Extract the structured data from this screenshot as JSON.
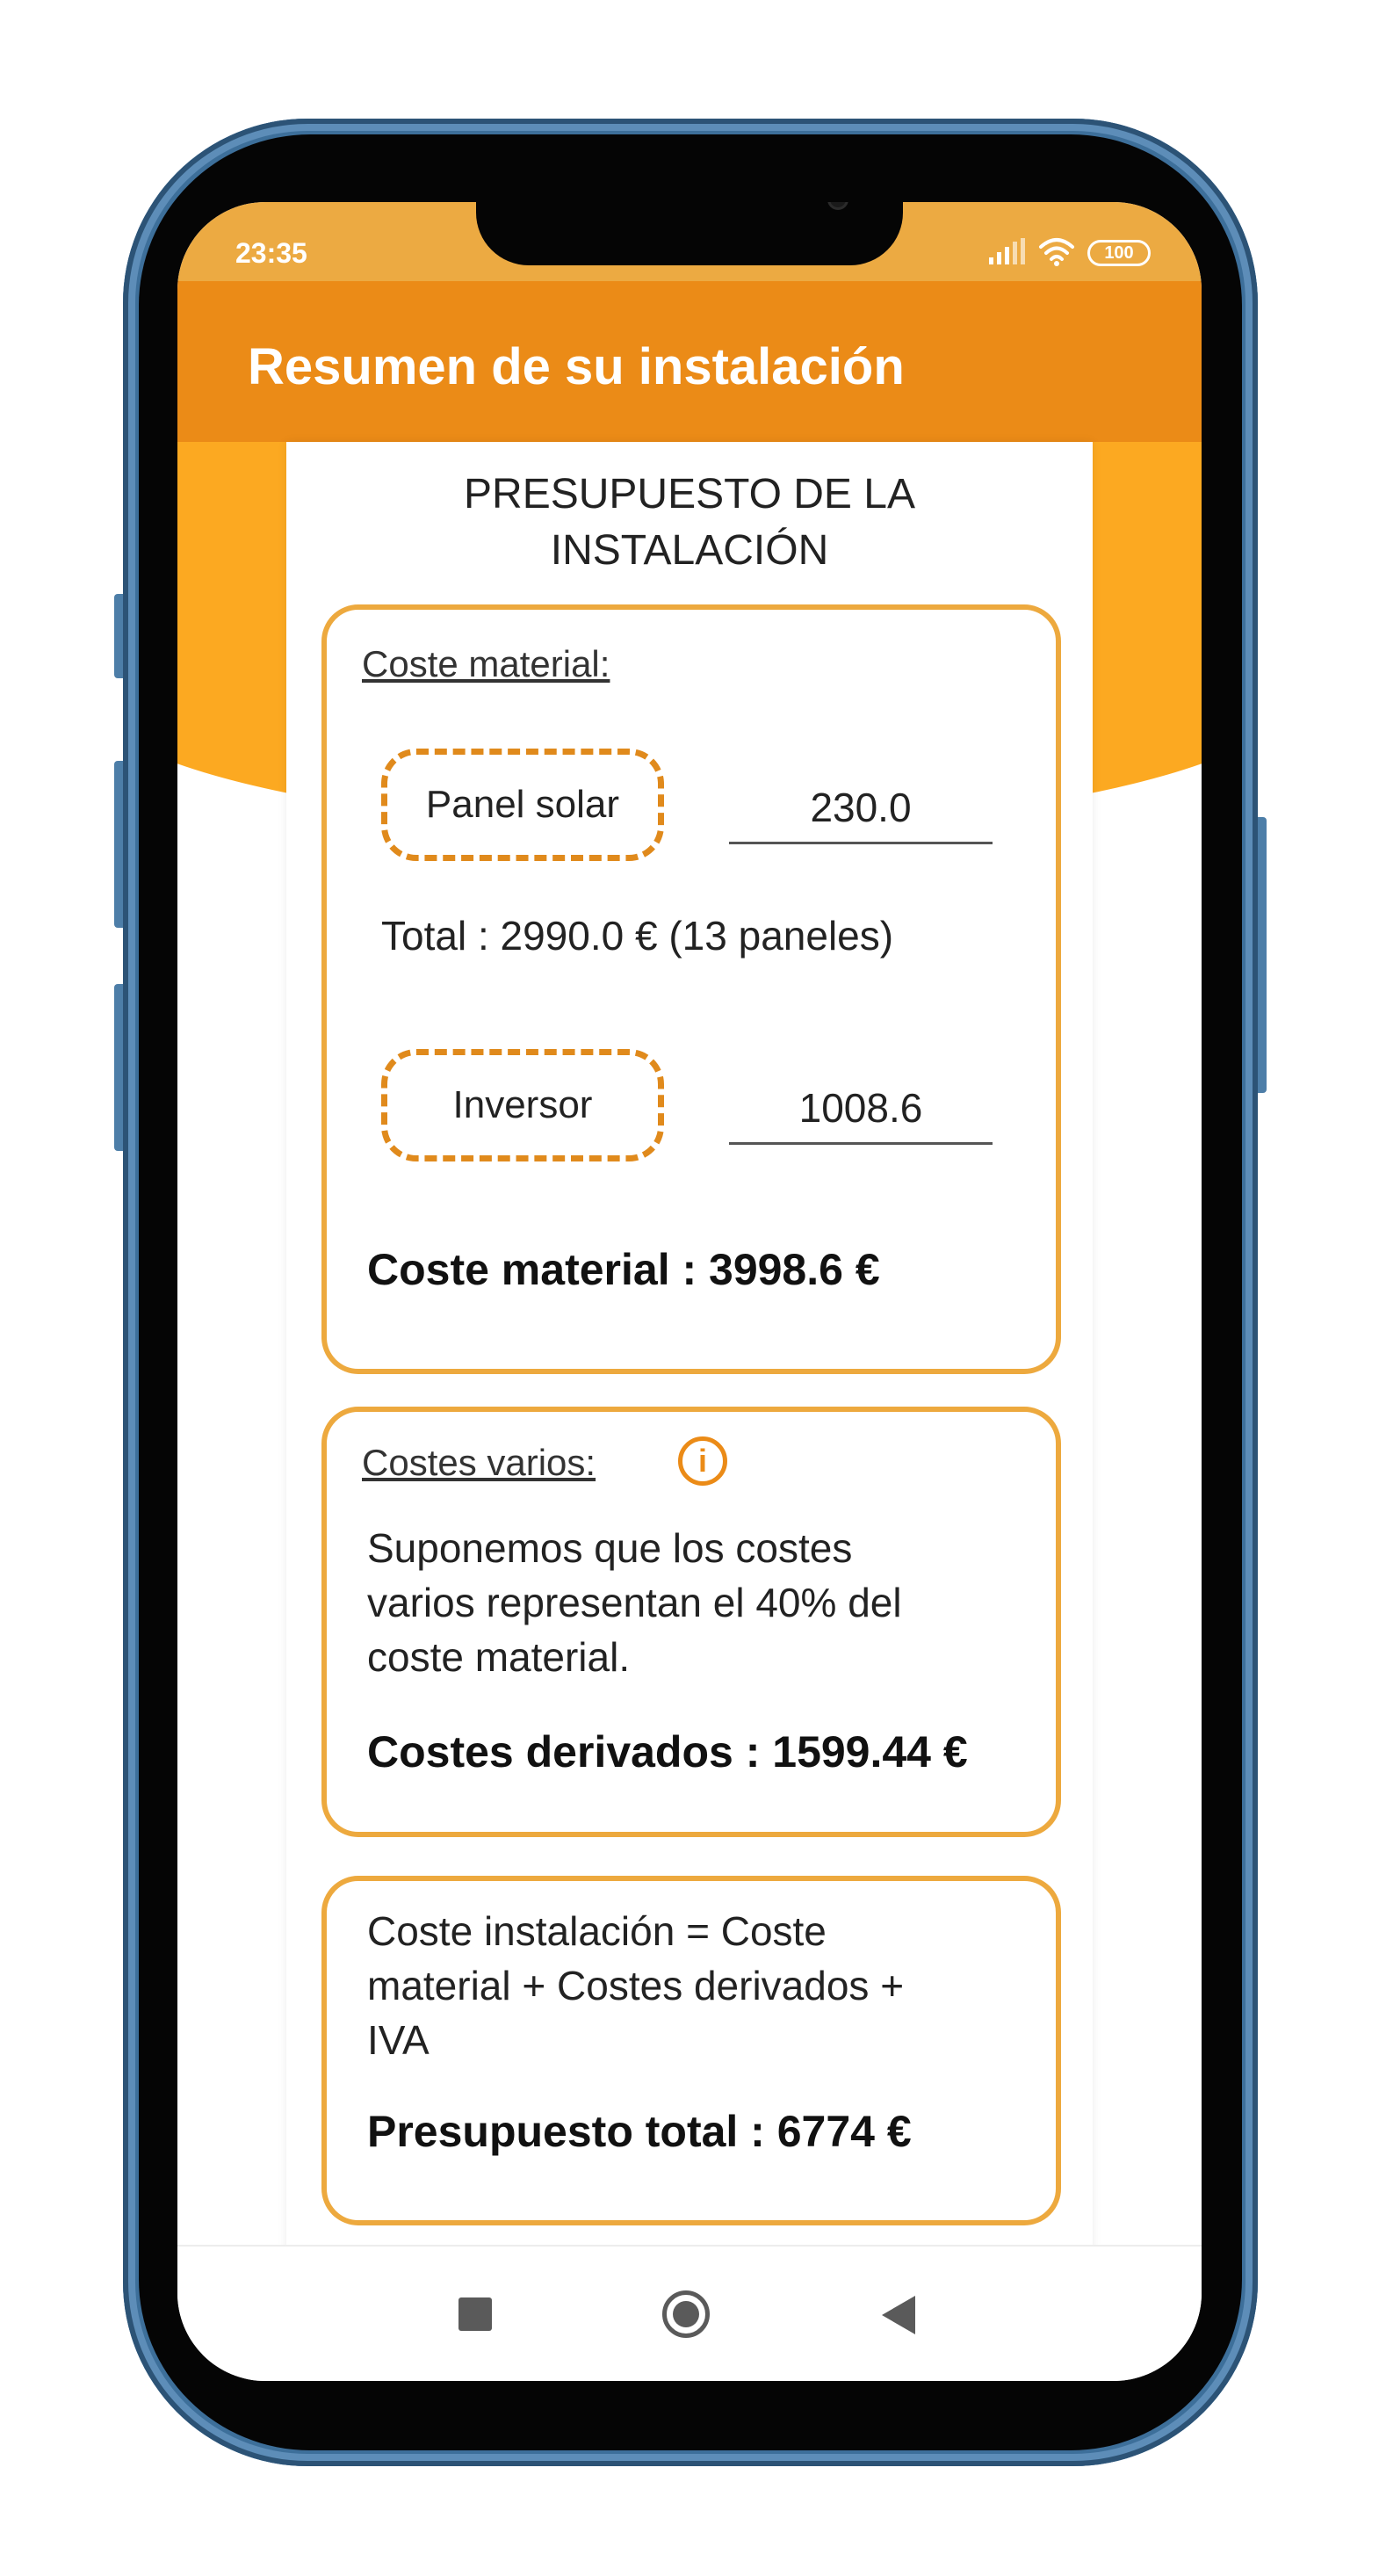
{
  "status_bar": {
    "time": "23:35",
    "battery": "100"
  },
  "app_bar": {
    "title": "Resumen de su instalación"
  },
  "content": {
    "title_line1": "PRESUPUESTO DE LA",
    "title_line2": "INSTALACIÓN",
    "material": {
      "heading": "Coste material:",
      "panel_label": "Panel solar",
      "panel_value": "230.0",
      "panel_total": "Total : 2990.0 €  (13 paneles)",
      "inverter_label": "Inversor",
      "inverter_value": "1008.6",
      "summary": "Coste material : 3998.6 €"
    },
    "varios": {
      "heading": "Costes varios:",
      "info_glyph": "i",
      "description_line1": "Suponemos que los costes",
      "description_line2": "varios representan el 40% del",
      "description_line3": "coste material.",
      "summary": "Costes derivados : 1599.44 €"
    },
    "total": {
      "formula_line1": "Coste instalación = Coste",
      "formula_line2": "material + Costes derivados +",
      "formula_line3": "IVA",
      "summary": "Presupuesto total : 6774 €"
    }
  },
  "colors": {
    "accent_orange": "#eb8b17",
    "status_orange": "#ecaa42",
    "curve_orange": "#fca921",
    "border_orange": "#eda93e"
  },
  "icons": {
    "nav_recent": "square-icon",
    "nav_home": "circle-icon",
    "nav_back": "triangle-back-icon",
    "info": "info-icon",
    "signal": "signal-icon",
    "wifi": "wifi-icon",
    "battery": "battery-icon"
  }
}
